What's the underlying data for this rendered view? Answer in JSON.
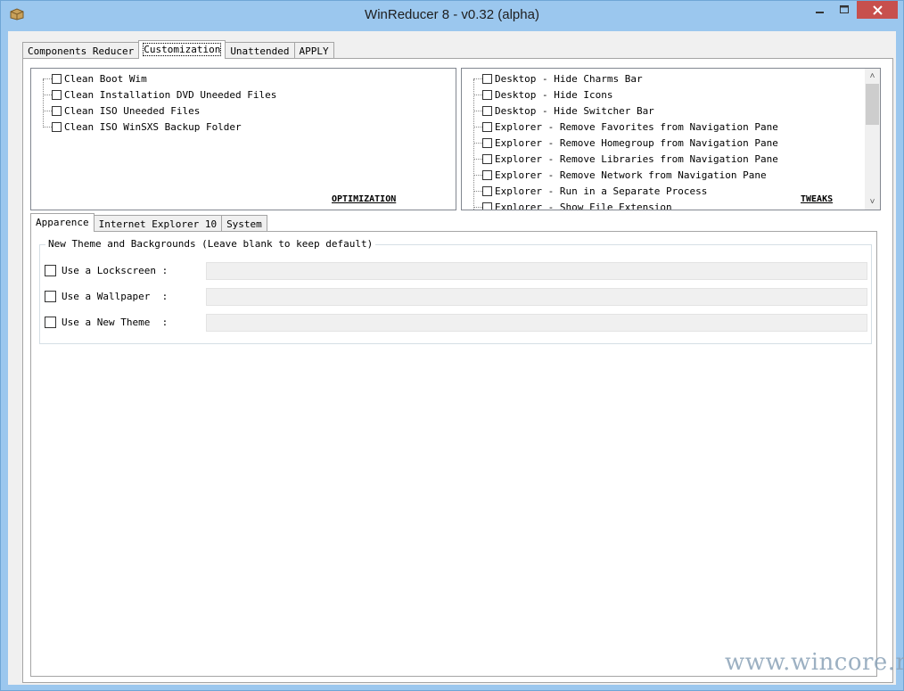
{
  "window": {
    "title": "WinReducer 8 - v0.32 (alpha)",
    "controls": {
      "minimize": "minimize-icon",
      "maximize": "maximize-icon",
      "close": "close-icon"
    },
    "accent_color": "#9bc7ee",
    "close_color": "#c7504d"
  },
  "main_tabs": [
    {
      "label": "Components Reducer",
      "active": false
    },
    {
      "label": "Customization",
      "active": true
    },
    {
      "label": "Unattended",
      "active": false
    },
    {
      "label": "APPLY",
      "active": false
    }
  ],
  "optimization": {
    "label": "OPTIMIZATION",
    "items": [
      {
        "label": "Clean Boot Wim",
        "checked": false
      },
      {
        "label": "Clean Installation DVD Uneeded Files",
        "checked": false
      },
      {
        "label": "Clean ISO Uneeded Files",
        "checked": false
      },
      {
        "label": "Clean ISO WinSXS Backup Folder",
        "checked": false
      }
    ]
  },
  "tweaks": {
    "label": "TWEAKS",
    "items": [
      {
        "label": "Desktop - Hide Charms Bar",
        "checked": false
      },
      {
        "label": "Desktop - Hide Icons",
        "checked": false
      },
      {
        "label": "Desktop - Hide Switcher Bar",
        "checked": false
      },
      {
        "label": "Explorer - Remove Favorites from Navigation Pane",
        "checked": false
      },
      {
        "label": "Explorer - Remove Homegroup from Navigation Pane",
        "checked": false
      },
      {
        "label": "Explorer - Remove Libraries from Navigation Pane",
        "checked": false
      },
      {
        "label": "Explorer - Remove Network from Navigation Pane",
        "checked": false
      },
      {
        "label": "Explorer - Run in a Separate Process",
        "checked": false
      },
      {
        "label": "Explorer - Show File Extension",
        "checked": false
      }
    ]
  },
  "sub_tabs": [
    {
      "label": "Apparence",
      "active": true
    },
    {
      "label": "Internet Explorer 10",
      "active": false
    },
    {
      "label": "System",
      "active": false
    }
  ],
  "theme_group": {
    "title": "New Theme and Backgrounds (Leave blank to keep default)",
    "rows": [
      {
        "label": "Use a Lockscreen :",
        "value": "",
        "checked": false
      },
      {
        "label": "Use a Wallpaper  :",
        "value": "",
        "checked": false
      },
      {
        "label": "Use a New Theme  :",
        "value": "",
        "checked": false
      }
    ]
  },
  "watermark": "www.wincore.ru"
}
